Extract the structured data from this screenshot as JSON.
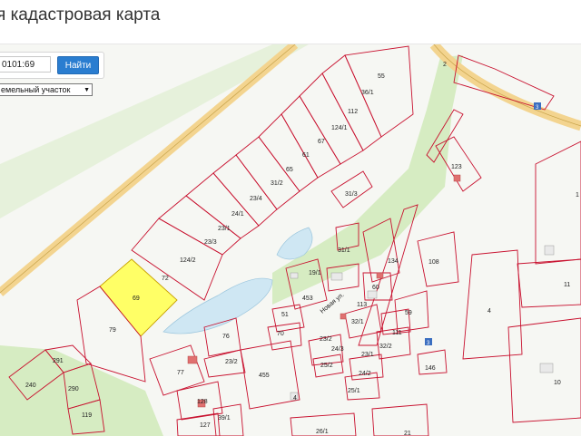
{
  "header": {
    "title": "я кадастровая карта"
  },
  "search": {
    "value": "0101:69",
    "button_label": "Найти"
  },
  "layer_select": {
    "selected": "емельный участок"
  },
  "colors": {
    "parcel_outline": "#c8102e",
    "highlight": "#ffff66",
    "water": "#cfe7f3",
    "green": "#d6ecc2",
    "road": "#f3d48f"
  },
  "map": {
    "road_label": "2",
    "parcels": [
      {
        "id": "p55",
        "label": "55"
      },
      {
        "id": "p36_1",
        "label": "36/1"
      },
      {
        "id": "p112",
        "label": "112"
      },
      {
        "id": "p124_1",
        "label": "124/1"
      },
      {
        "id": "p67",
        "label": "67"
      },
      {
        "id": "p61",
        "label": "61"
      },
      {
        "id": "p65",
        "label": "65"
      },
      {
        "id": "p31_2",
        "label": "31/2"
      },
      {
        "id": "p31_3",
        "label": "31/3"
      },
      {
        "id": "p23_4",
        "label": "23/4"
      },
      {
        "id": "p24_1",
        "label": "24/1"
      },
      {
        "id": "p23_1",
        "label": "23/1"
      },
      {
        "id": "p23_3",
        "label": "23/3"
      },
      {
        "id": "p124_2",
        "label": "124/2"
      },
      {
        "id": "p72",
        "label": "72"
      },
      {
        "id": "p69",
        "label": "69"
      },
      {
        "id": "p79",
        "label": "79"
      },
      {
        "id": "p123",
        "label": "123"
      },
      {
        "id": "p31_1",
        "label": "31/1"
      },
      {
        "id": "p19_1",
        "label": "19/1"
      },
      {
        "id": "p453",
        "label": "453"
      },
      {
        "id": "p134",
        "label": "134"
      },
      {
        "id": "p108",
        "label": "108"
      },
      {
        "id": "p60",
        "label": "60"
      },
      {
        "id": "p113",
        "label": "113"
      },
      {
        "id": "p59",
        "label": "59"
      },
      {
        "id": "p51",
        "label": "51"
      },
      {
        "id": "p70",
        "label": "70"
      },
      {
        "id": "p32_1",
        "label": "32/1"
      },
      {
        "id": "p111",
        "label": "111"
      },
      {
        "id": "p23_2",
        "label": "23/2"
      },
      {
        "id": "p24_3",
        "label": "24/3"
      },
      {
        "id": "p32_2",
        "label": "32/2"
      },
      {
        "id": "p25_2",
        "label": "25/2"
      },
      {
        "id": "p23_1b",
        "label": "23/1"
      },
      {
        "id": "p24_2",
        "label": "24/2"
      },
      {
        "id": "p25_1",
        "label": "25/1"
      },
      {
        "id": "p146",
        "label": "146"
      },
      {
        "id": "p76",
        "label": "76"
      },
      {
        "id": "p77",
        "label": "77"
      },
      {
        "id": "p23_2b",
        "label": "23/2"
      },
      {
        "id": "p455",
        "label": "455"
      },
      {
        "id": "p291",
        "label": "291"
      },
      {
        "id": "p240",
        "label": "240"
      },
      {
        "id": "p290",
        "label": "290"
      },
      {
        "id": "p119",
        "label": "119"
      },
      {
        "id": "p128",
        "label": "128"
      },
      {
        "id": "p127",
        "label": "127"
      },
      {
        "id": "p39_1",
        "label": "39/1"
      },
      {
        "id": "p26_1",
        "label": "26/1"
      },
      {
        "id": "p21",
        "label": "21"
      },
      {
        "id": "p4",
        "label": "4"
      },
      {
        "id": "p4b",
        "label": "4"
      },
      {
        "id": "p11",
        "label": "11"
      },
      {
        "id": "p10",
        "label": "10"
      },
      {
        "id": "p1",
        "label": "1"
      }
    ],
    "street_label": "Новая ул.",
    "marker_label": "3"
  }
}
